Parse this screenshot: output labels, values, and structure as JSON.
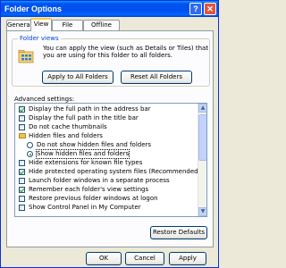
{
  "window": {
    "title": "Folder Options",
    "help_label": "?",
    "close_label": "✕"
  },
  "tabs": [
    {
      "label": "General"
    },
    {
      "label": "View"
    },
    {
      "label": "File Types"
    },
    {
      "label": "Offline Files"
    }
  ],
  "folder_views": {
    "legend": "Folder views",
    "description": "You can apply the view (such as Details or Tiles) that you are using for this folder to all folders.",
    "apply_label": "Apply to All Folders",
    "reset_label": "Reset All Folders"
  },
  "advanced": {
    "label": "Advanced settings:",
    "items": [
      {
        "kind": "checkbox",
        "checked": true,
        "label": "Display the full path in the address bar"
      },
      {
        "kind": "checkbox",
        "checked": false,
        "label": "Display the full path in the title bar"
      },
      {
        "kind": "checkbox",
        "checked": false,
        "label": "Do not cache thumbnails"
      },
      {
        "kind": "folder",
        "label": "Hidden files and folders"
      },
      {
        "kind": "radio",
        "checked": false,
        "label": "Do not show hidden files and folders"
      },
      {
        "kind": "radio",
        "checked": true,
        "label": "Show hidden files and folders"
      },
      {
        "kind": "checkbox",
        "checked": false,
        "label": "Hide extensions for known file types"
      },
      {
        "kind": "checkbox",
        "checked": true,
        "label": "Hide protected operating system files (Recommended)"
      },
      {
        "kind": "checkbox",
        "checked": false,
        "label": "Launch folder windows in a separate process"
      },
      {
        "kind": "checkbox",
        "checked": true,
        "label": "Remember each folder's view settings"
      },
      {
        "kind": "checkbox",
        "checked": false,
        "label": "Restore previous folder windows at logon"
      },
      {
        "kind": "checkbox",
        "checked": false,
        "label": "Show Control Panel in My Computer"
      }
    ],
    "restore_label": "Restore Defaults"
  },
  "footer": {
    "ok_label": "OK",
    "cancel_label": "Cancel",
    "apply_label": "Apply"
  }
}
